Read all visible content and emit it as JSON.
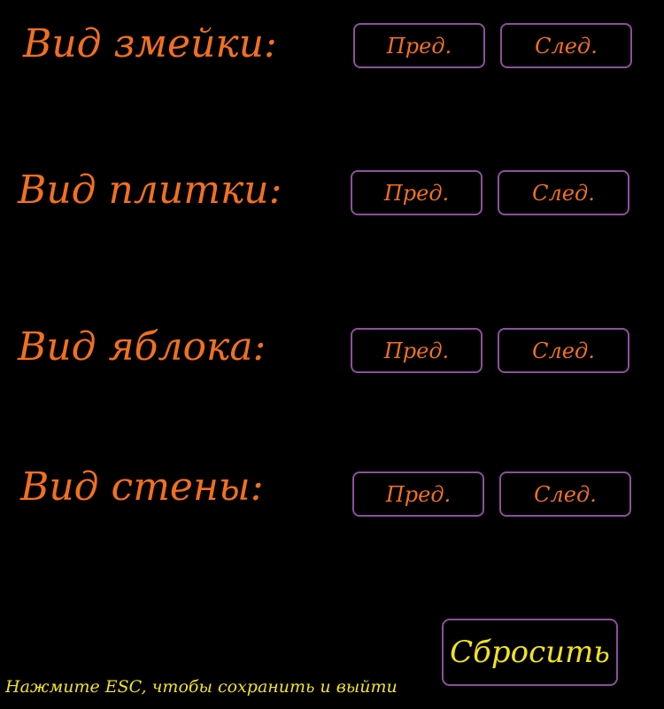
{
  "rows": [
    {
      "label": "Вид змейки:",
      "prev_label": "Пред.",
      "next_label": "След."
    },
    {
      "label": "Вид плитки:",
      "prev_label": "Пред.",
      "next_label": "След."
    },
    {
      "label": "Вид яблока:",
      "prev_label": "Пред.",
      "next_label": "След."
    },
    {
      "label": "Вид стены:",
      "prev_label": "Пред.",
      "next_label": "След."
    }
  ],
  "reset_label": "Сбросить",
  "hint": "Нажмите ESC, чтобы сохранить и выйти",
  "colors": {
    "background": "#000000",
    "label": "#f2701e",
    "button_border": "#8e4f9c",
    "reset_text": "#f1e21f",
    "hint_text": "#f1e21f"
  }
}
